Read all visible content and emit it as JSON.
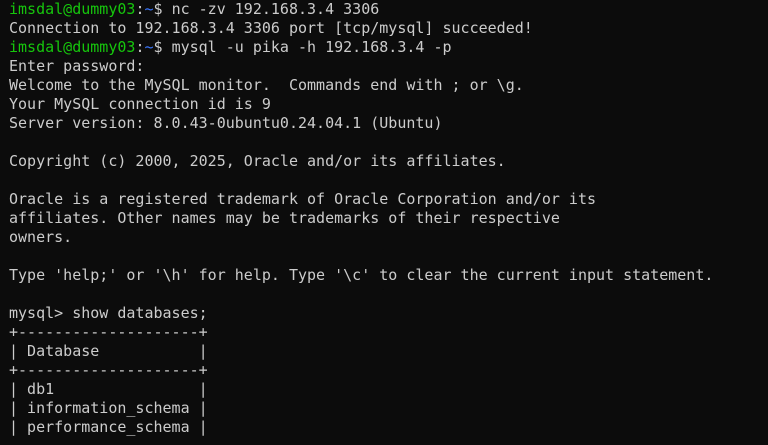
{
  "colors": {
    "background": "#0c0c0c",
    "text": "#cccccc",
    "prompt_user": "#16c60c",
    "prompt_path": "#3b78ff"
  },
  "shell": {
    "prompt1": {
      "user_host": "imsdal@dummy03",
      "colon": ":",
      "path": "~",
      "dollar": "$ ",
      "command": "nc -zv 192.168.3.4 3306"
    },
    "nc_output": "Connection to 192.168.3.4 3306 port [tcp/mysql] succeeded!",
    "prompt2": {
      "user_host": "imsdal@dummy03",
      "colon": ":",
      "path": "~",
      "dollar": "$ ",
      "command": "mysql -u pika -h 192.168.3.4 -p"
    }
  },
  "mysql": {
    "enter_password": "Enter password:",
    "welcome": "Welcome to the MySQL monitor.  Commands end with ; or \\g.",
    "connection_id": "Your MySQL connection id is 9",
    "server_version": "Server version: 8.0.43-0ubuntu0.24.04.1 (Ubuntu)",
    "copyright": "Copyright (c) 2000, 2025, Oracle and/or its affiliates.",
    "trademark_1": "Oracle is a registered trademark of Oracle Corporation and/or its",
    "trademark_2": "affiliates. Other names may be trademarks of their respective",
    "trademark_3": "owners.",
    "help": "Type 'help;' or '\\h' for help. Type '\\c' to clear the current input statement.",
    "query_prompt": "mysql> ",
    "query": "show databases;",
    "table": {
      "border": "+--------------------+",
      "header": "| Database           |",
      "rows": [
        "| db1                |",
        "| information_schema |",
        "| performance_schema |"
      ]
    }
  }
}
